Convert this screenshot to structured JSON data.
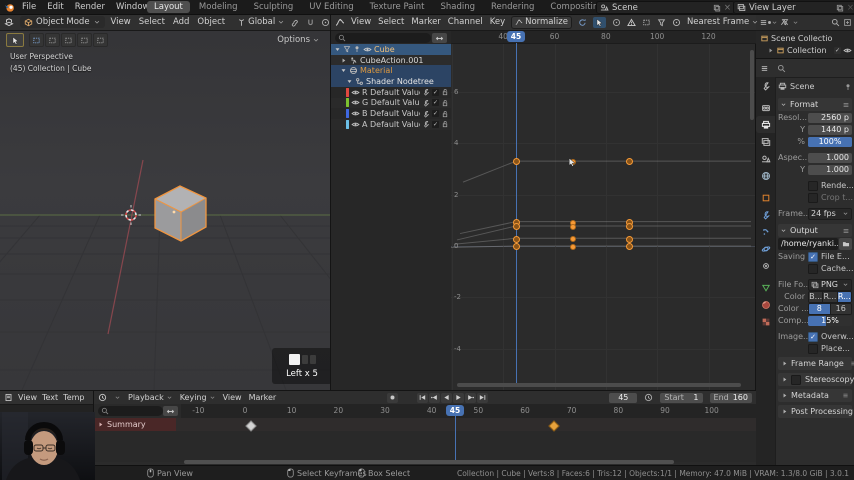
{
  "topbar": {
    "menus": [
      "File",
      "Edit",
      "Render",
      "Window",
      "Help"
    ],
    "workspace_tabs": [
      "Layout",
      "Modeling",
      "Sculpting",
      "UV Editing",
      "Texture Paint",
      "Shading",
      "Rendering",
      "Compositing",
      "+"
    ],
    "active_tab": "Layout",
    "scene_selector": "Scene",
    "view_layer_selector": "View Layer"
  },
  "viewport": {
    "mode_selector": "Object Mode",
    "menus": [
      "View",
      "Select",
      "Add",
      "Object"
    ],
    "orientation": "Global",
    "options_button": "Options",
    "overlay": {
      "line1": "User Perspective",
      "line2": "(45) Collection | Cube"
    },
    "screencast_keys": "Left x 5"
  },
  "graph_editor": {
    "menus": [
      "View",
      "Select",
      "Marker",
      "Channel",
      "Key"
    ],
    "normalize_toggle": "Normalize",
    "snap_dropdown": "Nearest Frame",
    "channels": [
      {
        "name": "Cube",
        "type": "object",
        "indent": 0,
        "selected": true
      },
      {
        "name": "CubeAction.001",
        "type": "action",
        "indent": 1,
        "selected": false
      },
      {
        "name": "Material",
        "type": "material",
        "indent": 1,
        "selected": true
      },
      {
        "name": "Shader Nodetree",
        "type": "nodetree",
        "indent": 2,
        "selected": true
      },
      {
        "name": "R Default Value (Co",
        "type": "fcurve",
        "indent": 2,
        "swatch": "#e14840"
      },
      {
        "name": "G Default Value (Co",
        "type": "fcurve",
        "indent": 2,
        "swatch": "#7dc230"
      },
      {
        "name": "B Default Value (Co",
        "type": "fcurve",
        "indent": 2,
        "swatch": "#3f68e0"
      },
      {
        "name": "A Default Value (Co",
        "type": "fcurve",
        "indent": 2,
        "swatch": "#6cc0e8"
      }
    ],
    "ruler_ticks": [
      40,
      60,
      80,
      100,
      120
    ],
    "current_frame": "45",
    "y_ticks": [
      6,
      4,
      2,
      0,
      -2,
      -4
    ],
    "keyframes": {
      "frames": [
        45,
        67,
        89
      ],
      "row_values": [
        3.3,
        0.95,
        0.78,
        0.3,
        0
      ]
    }
  },
  "outliner": {
    "rows": [
      {
        "label": "Scene Collectio",
        "indent": 0,
        "checkbox": false,
        "eye": false
      },
      {
        "label": "Collection",
        "indent": 1,
        "checkbox": true,
        "eye": true
      }
    ]
  },
  "properties": {
    "breadcrumb": "Scene",
    "tabs": [
      "tool",
      "render",
      "output",
      "view-layer",
      "scene",
      "world",
      "object",
      "modifiers",
      "particles",
      "physics",
      "constraints",
      "object-data",
      "material",
      "texture"
    ],
    "active_tab": "output",
    "format_panel": {
      "title": "Format",
      "rows": [
        {
          "kind": "field",
          "label": "Resol...",
          "value": "2560 p"
        },
        {
          "kind": "field",
          "label": "Y",
          "value": "1440 p"
        },
        {
          "kind": "slider",
          "label": "%",
          "value": "100%",
          "fill": 1
        },
        {
          "kind": "field",
          "label": "Aspec...",
          "value": "1.000",
          "gap": true
        },
        {
          "kind": "field",
          "label": "Y",
          "value": "1.000"
        },
        {
          "kind": "checkbox",
          "label": "",
          "text": "Rende...",
          "checked": false,
          "gap": true
        },
        {
          "kind": "checkbox",
          "label": "",
          "text": "Crop t...",
          "checked": false,
          "disabled": true
        },
        {
          "kind": "dropdown",
          "label": "Frame...",
          "value": "24 fps",
          "gap": true
        }
      ]
    },
    "output_panel": {
      "title": "Output",
      "rows": [
        {
          "kind": "path",
          "value": "/home/ryanki..."
        },
        {
          "kind": "checkbox",
          "label": "Saving",
          "text": "File E...",
          "checked": true
        },
        {
          "kind": "checkbox",
          "label": "",
          "text": "Cache...",
          "checked": false
        },
        {
          "kind": "dropdown-image",
          "label": "File Fo...",
          "value": "PNG",
          "gap": true
        },
        {
          "kind": "segmented",
          "label": "Color",
          "options": [
            "B...",
            "R...",
            "R..."
          ],
          "selected": 2
        },
        {
          "kind": "segmented",
          "label": "Color ...",
          "options": [
            "8",
            "16"
          ],
          "selected": 0
        },
        {
          "kind": "slider",
          "label": "Comp...",
          "value": "15%",
          "fill": 0.42
        },
        {
          "kind": "checkbox",
          "label": "Image...",
          "text": "Overw...",
          "checked": true,
          "gap": true
        },
        {
          "kind": "checkbox",
          "label": "",
          "text": "Place...",
          "checked": false
        }
      ]
    },
    "collapsed_panels": [
      {
        "title": "Frame Range",
        "checkbox": false
      },
      {
        "title": "Stereoscopy",
        "checkbox": true
      },
      {
        "title": "Metadata",
        "checkbox": false
      },
      {
        "title": "Post Processing",
        "checkbox": false
      }
    ]
  },
  "text_editor": {
    "menus": [
      "View",
      "Text",
      "Temp"
    ]
  },
  "timeline": {
    "menus": [
      {
        "label": "Playback",
        "chev": true
      },
      {
        "label": "Keying",
        "chev": true
      },
      {
        "label": "View",
        "chev": false
      },
      {
        "label": "Marker",
        "chev": false
      }
    ],
    "current_frame": "45",
    "start_field": {
      "label": "Start",
      "value": "1"
    },
    "end_field": {
      "label": "End",
      "value": "160"
    },
    "ruler_ticks": [
      -10,
      0,
      10,
      20,
      30,
      40,
      50,
      60,
      70,
      80,
      90,
      100
    ],
    "channels": [
      {
        "label": "Summary"
      }
    ],
    "keyframes": [
      {
        "frame": 1,
        "selected": false
      },
      {
        "frame": 66,
        "selected": true
      }
    ]
  },
  "statusbar": {
    "hints": [
      {
        "label": "Pan View",
        "button": "middle"
      },
      {
        "label": "Select Keyframes",
        "button": "left"
      },
      {
        "label": "Box Select",
        "button": "left"
      }
    ],
    "stats": "Collection | Cube | Verts:8 | Faces:6 | Tris:12 | Objects:1/1 | Memory: 47.0 MiB | VRAM: 1.3/8.0 GiB | 3.0.1"
  },
  "colors": {
    "accent_blue": "#4772b3",
    "keyframe_orange": "#f79a36",
    "object_orange": "#e8822d",
    "selected_channel_bg": "#35587e"
  }
}
